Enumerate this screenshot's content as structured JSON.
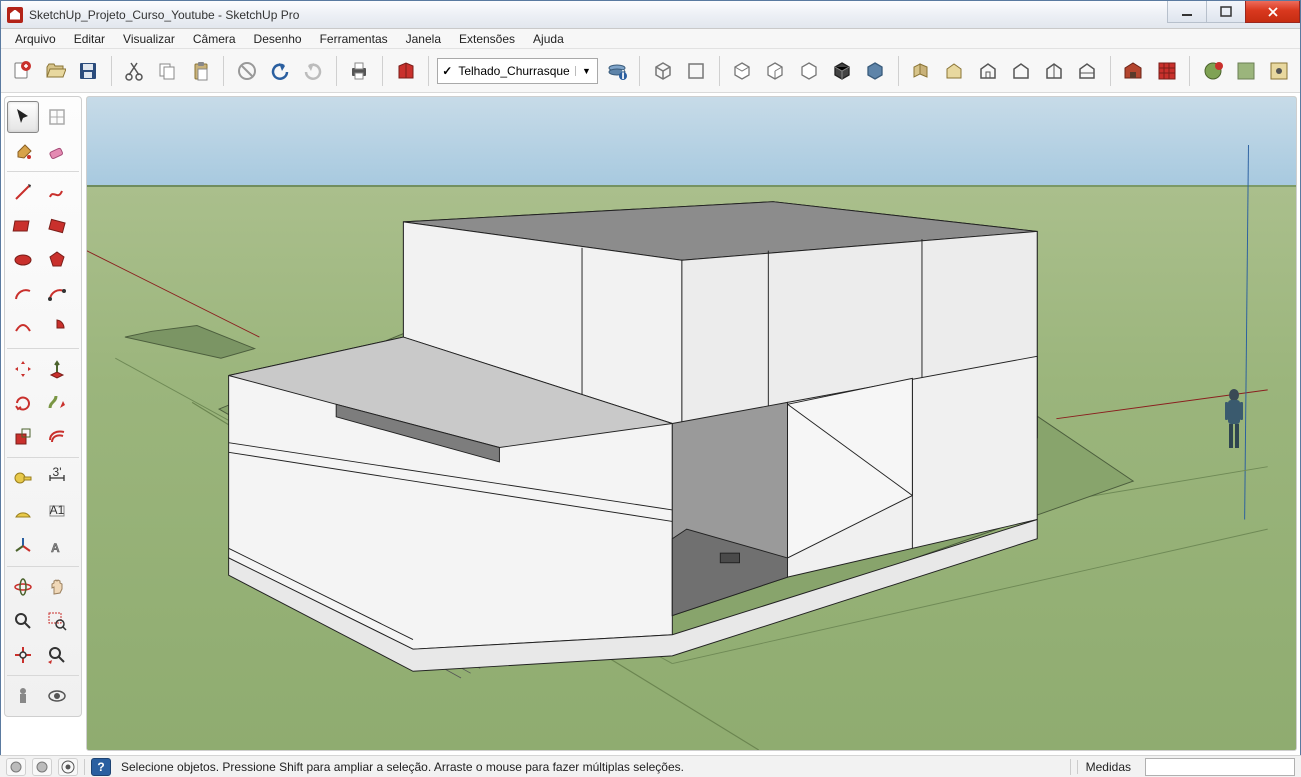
{
  "window": {
    "title": "SketchUp_Projeto_Curso_Youtube - SketchUp Pro"
  },
  "menu": {
    "items": [
      "Arquivo",
      "Editar",
      "Visualizar",
      "Câmera",
      "Desenho",
      "Ferramentas",
      "Janela",
      "Extensões",
      "Ajuda"
    ]
  },
  "layer_combo": {
    "checked_mark": "✓",
    "value": "Telhado_Churrasque"
  },
  "status": {
    "hint": "Selecione objetos. Pressione Shift para ampliar a seleção. Arraste o mouse para fazer múltiplas seleções.",
    "measure_label": "Medidas"
  }
}
